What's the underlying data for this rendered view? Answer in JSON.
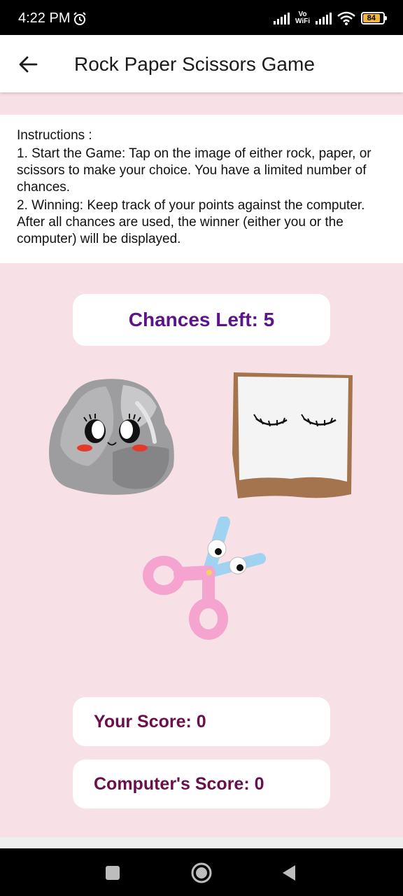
{
  "status_bar": {
    "time": "4:22 PM",
    "vowifi_top": "Vo",
    "vowifi_bottom": "WiFi",
    "battery": "84",
    "icons": [
      "alarm-icon",
      "signal-icon",
      "wifi-icon",
      "battery-icon"
    ]
  },
  "app_bar": {
    "back_icon": "arrow-left-icon",
    "title": "Rock Paper Scissors Game"
  },
  "instructions": {
    "heading": "Instructions :",
    "step1": "1. Start the Game: Tap on the image of either rock, paper, or scissors to make your choice. You have a limited number of chances.",
    "step2": "2. Winning: Keep track of your points against the computer. After all chances are used, the winner (either you or the computer) will be displayed."
  },
  "game": {
    "chances_left": "Chances Left: 5",
    "choices": [
      "rock",
      "paper",
      "scissors"
    ],
    "your_score": "Your Score: 0",
    "computer_score": "Computer's Score: 0"
  },
  "colors": {
    "background": "#f8e1e6",
    "chances_text": "#5c1488",
    "score_text": "#6b0f4c"
  },
  "nav_bar": {
    "icons": [
      "recents-square-icon",
      "home-circle-icon",
      "back-triangle-icon"
    ]
  }
}
